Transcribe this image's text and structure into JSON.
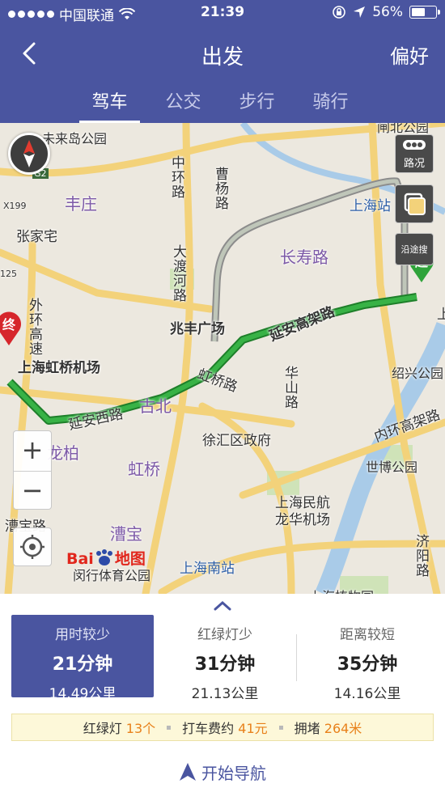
{
  "status_bar": {
    "carrier": "中国联通",
    "time": "21:39",
    "battery": "56%",
    "battery_level": 0.56
  },
  "header": {
    "title": "出发",
    "prefs": "偏好"
  },
  "tabs": [
    {
      "label": "驾车",
      "active": true
    },
    {
      "label": "公交",
      "active": false
    },
    {
      "label": "步行",
      "active": false
    },
    {
      "label": "骑行",
      "active": false
    }
  ],
  "map": {
    "labels": {
      "weilai": "未来岛公园",
      "fengzhuang": "丰庄",
      "zhangjiazhai": "张家宅",
      "zhonghuan": "中环路",
      "caoyang": "曹杨路",
      "dadu": "大渡河路",
      "zhaofeng": "兆丰广场",
      "changshou": "长寿路",
      "shanghai_station": "上海站",
      "zhabei": "闸北公园",
      "yanan_elevated": "延安高架路",
      "outer_ring": "外环高速",
      "hongqiao_airport": "上海虹桥机场",
      "yanan_west": "延安西路",
      "gubei": "古北",
      "hongqiao_rd": "虹桥路",
      "huashan": "华山路",
      "shaoxing": "绍兴公园",
      "inner_ring": "内环高架路",
      "xuhui": "徐汇区政府",
      "longbai": "龙柏",
      "hongqiao": "虹桥",
      "shibo": "世博公园",
      "longhua_airport": "上海民航龙华机场",
      "caobao_rd": "漕宝路",
      "caobao": "漕宝",
      "minhang_sports": "闵行体育公园",
      "south_station": "上海南站",
      "jiyang": "济阳路",
      "botanical": "上海植物园",
      "end_marker": "终",
      "start_marker": "起",
      "shang": "上",
      "x199": "X199",
      "g2": "G2",
      "road125": "125",
      "waihuan_short": "外"
    },
    "controls": {
      "traffic": "路况",
      "along_search": "沿途搜",
      "zoom_in": "+",
      "zoom_out": "−"
    },
    "logo": {
      "text_left": "Bai",
      "text_right": "地图"
    }
  },
  "routes": [
    {
      "title": "用时较少",
      "time": "21分钟",
      "distance": "14.49公里",
      "selected": true
    },
    {
      "title": "红绿灯少",
      "time": "31分钟",
      "distance": "21.13公里",
      "selected": false
    },
    {
      "title": "距离较短",
      "time": "35分钟",
      "distance": "14.16公里",
      "selected": false
    }
  ],
  "info": {
    "lights_label": "红绿灯",
    "lights_value": "13个",
    "taxi_label": "打车费约",
    "taxi_value": "41元",
    "congestion_label": "拥堵",
    "congestion_value": "264米"
  },
  "start_navigation": "开始导航",
  "colors": {
    "header": "#4a55a0",
    "route_green": "#2fa33a",
    "highlight": "#e8811b"
  }
}
